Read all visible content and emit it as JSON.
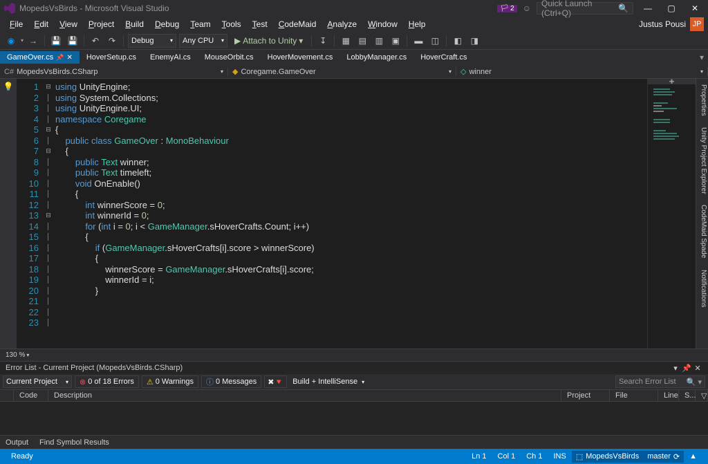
{
  "titlebar": {
    "title": "MopedsVsBirds - Microsoft Visual Studio",
    "notif_count": "2",
    "search_placeholder": "Quick Launch (Ctrl+Q)"
  },
  "menus": [
    "File",
    "Edit",
    "View",
    "Project",
    "Build",
    "Debug",
    "Team",
    "Tools",
    "Test",
    "CodeMaid",
    "Analyze",
    "Window",
    "Help"
  ],
  "user": {
    "name": "Justus Pousi",
    "initials": "JP"
  },
  "toolbar": {
    "config": "Debug",
    "platform": "Any CPU",
    "attach": "Attach to Unity"
  },
  "tabs": [
    {
      "label": "GameOver.cs",
      "active": true
    },
    {
      "label": "HoverSetup.cs"
    },
    {
      "label": "EnemyAI.cs"
    },
    {
      "label": "MouseOrbit.cs"
    },
    {
      "label": "HoverMovement.cs"
    },
    {
      "label": "LobbyManager.cs"
    },
    {
      "label": "HoverCraft.cs"
    }
  ],
  "nav": {
    "project": "MopedsVsBirds.CSharp",
    "class": "Coregame.GameOver",
    "member": "winner"
  },
  "code": {
    "lines": [
      {
        "n": 1,
        "fold": "⊟",
        "tokens": [
          [
            "kw",
            "using"
          ],
          [
            "txt",
            " "
          ],
          [
            "txt",
            "UnityEngine"
          ],
          [
            "txt",
            ";"
          ]
        ]
      },
      {
        "n": 2,
        "tokens": [
          [
            "kw",
            "using"
          ],
          [
            "txt",
            " "
          ],
          [
            "txt",
            "System.Collections"
          ],
          [
            "txt",
            ";"
          ]
        ]
      },
      {
        "n": 3,
        "tokens": [
          [
            "kw",
            "using"
          ],
          [
            "txt",
            " "
          ],
          [
            "txt",
            "UnityEngine.UI"
          ],
          [
            "txt",
            ";"
          ]
        ]
      },
      {
        "n": 4,
        "tokens": []
      },
      {
        "n": 5,
        "fold": "⊟",
        "tokens": [
          [
            "kw",
            "namespace"
          ],
          [
            "txt",
            " "
          ],
          [
            "type",
            "Coregame"
          ]
        ]
      },
      {
        "n": 6,
        "tokens": [
          [
            "txt",
            "{"
          ]
        ]
      },
      {
        "n": 7,
        "fold": "⊟",
        "tokens": [
          [
            "txt",
            "    "
          ],
          [
            "kw",
            "public"
          ],
          [
            "txt",
            " "
          ],
          [
            "kw",
            "class"
          ],
          [
            "txt",
            " "
          ],
          [
            "type",
            "GameOver"
          ],
          [
            "txt",
            " : "
          ],
          [
            "type",
            "MonoBehaviour"
          ]
        ]
      },
      {
        "n": 8,
        "tokens": [
          [
            "txt",
            "    {"
          ]
        ]
      },
      {
        "n": 9,
        "tokens": []
      },
      {
        "n": 10,
        "tokens": [
          [
            "txt",
            "        "
          ],
          [
            "kw",
            "public"
          ],
          [
            "txt",
            " "
          ],
          [
            "type",
            "Text"
          ],
          [
            "txt",
            " winner;"
          ]
        ]
      },
      {
        "n": 11,
        "tokens": [
          [
            "txt",
            "        "
          ],
          [
            "kw",
            "public"
          ],
          [
            "txt",
            " "
          ],
          [
            "type",
            "Text"
          ],
          [
            "txt",
            " timeleft;"
          ]
        ]
      },
      {
        "n": 12,
        "tokens": []
      },
      {
        "n": 13,
        "fold": "⊟",
        "tokens": [
          [
            "txt",
            "        "
          ],
          [
            "kw",
            "void"
          ],
          [
            "txt",
            " "
          ],
          [
            "txt",
            "OnEnable()"
          ]
        ]
      },
      {
        "n": 14,
        "tokens": [
          [
            "txt",
            "        {"
          ]
        ]
      },
      {
        "n": 15,
        "tokens": [
          [
            "txt",
            "            "
          ],
          [
            "kw",
            "int"
          ],
          [
            "txt",
            " winnerScore = "
          ],
          [
            "num",
            "0"
          ],
          [
            "txt",
            ";"
          ]
        ]
      },
      {
        "n": 16,
        "tokens": [
          [
            "txt",
            "            "
          ],
          [
            "kw",
            "int"
          ],
          [
            "txt",
            " winnerId = "
          ],
          [
            "num",
            "0"
          ],
          [
            "txt",
            ";"
          ]
        ]
      },
      {
        "n": 17,
        "tokens": [
          [
            "txt",
            "            "
          ],
          [
            "kw",
            "for"
          ],
          [
            "txt",
            " ("
          ],
          [
            "kw",
            "int"
          ],
          [
            "txt",
            " i = "
          ],
          [
            "num",
            "0"
          ],
          [
            "txt",
            "; i < "
          ],
          [
            "type",
            "GameManager"
          ],
          [
            "txt",
            ".sHoverCrafts.Count; i++)"
          ]
        ]
      },
      {
        "n": 18,
        "tokens": [
          [
            "txt",
            "            {"
          ]
        ]
      },
      {
        "n": 19,
        "tokens": [
          [
            "txt",
            "                "
          ],
          [
            "kw",
            "if"
          ],
          [
            "txt",
            " ("
          ],
          [
            "type",
            "GameManager"
          ],
          [
            "txt",
            ".sHoverCrafts[i].score > winnerScore)"
          ]
        ]
      },
      {
        "n": 20,
        "tokens": [
          [
            "txt",
            "                {"
          ]
        ]
      },
      {
        "n": 21,
        "tokens": [
          [
            "txt",
            "                    winnerScore = "
          ],
          [
            "type",
            "GameManager"
          ],
          [
            "txt",
            ".sHoverCrafts[i].score;"
          ]
        ]
      },
      {
        "n": 22,
        "tokens": [
          [
            "txt",
            "                    winnerId = i;"
          ]
        ]
      },
      {
        "n": 23,
        "tokens": [
          [
            "txt",
            "                }"
          ]
        ]
      }
    ]
  },
  "zoom": "130 %",
  "error_list": {
    "title": "Error List - Current Project (MopedsVsBirds.CSharp)",
    "scope": "Current Project",
    "errors": "0 of 18 Errors",
    "warnings": "0 Warnings",
    "messages": "0 Messages",
    "filter": "Build + IntelliSense",
    "search_placeholder": "Search Error List",
    "cols": [
      "Code",
      "Description",
      "Project",
      "File",
      "Line",
      "S..."
    ]
  },
  "bottom_tabs": [
    "Output",
    "Find Symbol Results"
  ],
  "side_tabs": [
    "Properties",
    "Unity Project Explorer",
    "CodeMaid Spade",
    "Notifications"
  ],
  "status": {
    "ready": "Ready",
    "ln": "Ln 1",
    "col": "Col 1",
    "ch": "Ch 1",
    "ins": "INS",
    "repo": "MopedsVsBirds",
    "branch": "master"
  }
}
